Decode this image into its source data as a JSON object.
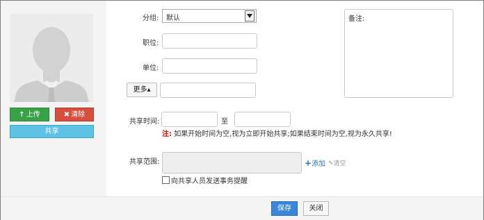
{
  "left_panel": {
    "avatar_icon": "default-person-silhouette",
    "upload_label": "上传",
    "clear_label": "清除",
    "share_label": "共享"
  },
  "form": {
    "group_label": "分组:",
    "group_value": "默认",
    "position_label": "职位:",
    "position_value": "",
    "company_label": "单位:",
    "company_value": "",
    "more_button": "更多",
    "more_value": "",
    "remark_label": "备注:",
    "share_time_label": "共享时间:",
    "share_time_from": "",
    "share_time_to_label": "至",
    "share_time_to": "",
    "note_prefix": "注:",
    "note_text": "如果开始时间为空,视为立即开始共享;如果结束时间为空,视为永久共享!",
    "share_scope_label": "共享范围:",
    "scope_value": "",
    "add_label": "添加",
    "clear_scope_label": "清空",
    "notify_label": "向共享人员发送事务提醒",
    "notify_checked": false
  },
  "footer": {
    "save_label": "保存",
    "close_label": "关闭"
  },
  "colors": {
    "upload_green": "#37a346",
    "clear_red": "#d84e3c",
    "share_blue": "#5dc2e6",
    "save_blue": "#3a86d8",
    "note_red": "#e00000",
    "link_blue": "#2b73b8"
  }
}
